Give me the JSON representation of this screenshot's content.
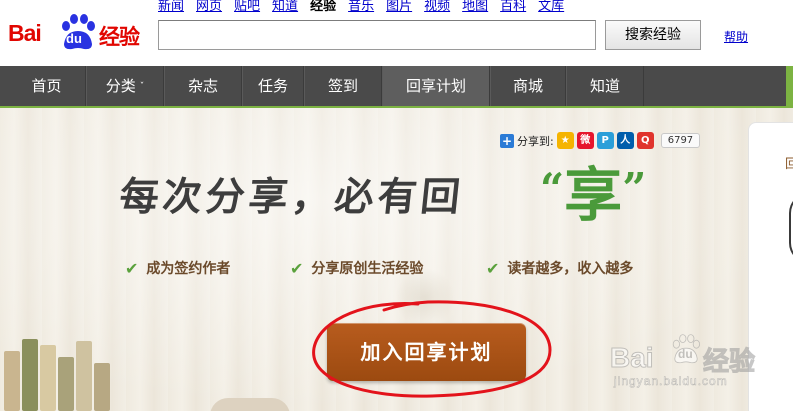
{
  "brand": {
    "logo_latin": "Bai",
    "logo_du": "du",
    "logo_cn": "经验"
  },
  "top_links": [
    {
      "label": "新闻",
      "active": false
    },
    {
      "label": "网页",
      "active": false
    },
    {
      "label": "贴吧",
      "active": false
    },
    {
      "label": "知道",
      "active": false
    },
    {
      "label": "经验",
      "active": true
    },
    {
      "label": "音乐",
      "active": false
    },
    {
      "label": "图片",
      "active": false
    },
    {
      "label": "视频",
      "active": false
    },
    {
      "label": "地图",
      "active": false
    },
    {
      "label": "百科",
      "active": false
    },
    {
      "label": "文库",
      "active": false
    }
  ],
  "search": {
    "value": "",
    "button_label": "搜索经验",
    "help_label": "帮助"
  },
  "nav": {
    "items": [
      {
        "label": "首页",
        "active": false,
        "dropdown": false
      },
      {
        "label": "分类",
        "active": false,
        "dropdown": true
      },
      {
        "label": "杂志",
        "active": false,
        "dropdown": false
      },
      {
        "label": "任务",
        "active": false,
        "dropdown": false
      },
      {
        "label": "签到",
        "active": false,
        "dropdown": false
      },
      {
        "label": "回享计划",
        "active": true,
        "dropdown": false
      },
      {
        "label": "商城",
        "active": false,
        "dropdown": false
      },
      {
        "label": "知道",
        "active": false,
        "dropdown": false
      }
    ],
    "caret": "ˇ"
  },
  "share": {
    "plus": "+",
    "label": "分享到:",
    "icons": [
      {
        "name": "qzone-icon",
        "glyph": "★",
        "color": "#f5b400"
      },
      {
        "name": "weibo-icon",
        "glyph": "微",
        "color": "#e6162d"
      },
      {
        "name": "tqq-icon",
        "glyph": "P",
        "color": "#2b9fd9"
      },
      {
        "name": "renren-icon",
        "glyph": "人",
        "color": "#005eac"
      },
      {
        "name": "qq-icon",
        "glyph": "Q",
        "color": "#e0342d"
      }
    ],
    "count": "6797"
  },
  "banner": {
    "headline": "每次分享，必有回",
    "headline_highlight": "享",
    "quote_open": "“",
    "quote_close": "”",
    "features": [
      "成为签约作者",
      "分享原创生活经验",
      "读者越多，收入越多"
    ],
    "check_glyph": "✔",
    "cta_label": "加入回享计划",
    "side_char": "回"
  },
  "watermark": {
    "bai": "Bai",
    "du": "du",
    "jy": "经验",
    "url": "jingyan.baidu.com"
  },
  "colors": {
    "brand_red": "#e10601",
    "nav_bg": "#4a4a4a",
    "accent_green": "#7cb342",
    "cta_brown": "#a8521a",
    "annotation_red": "#e3131b"
  }
}
